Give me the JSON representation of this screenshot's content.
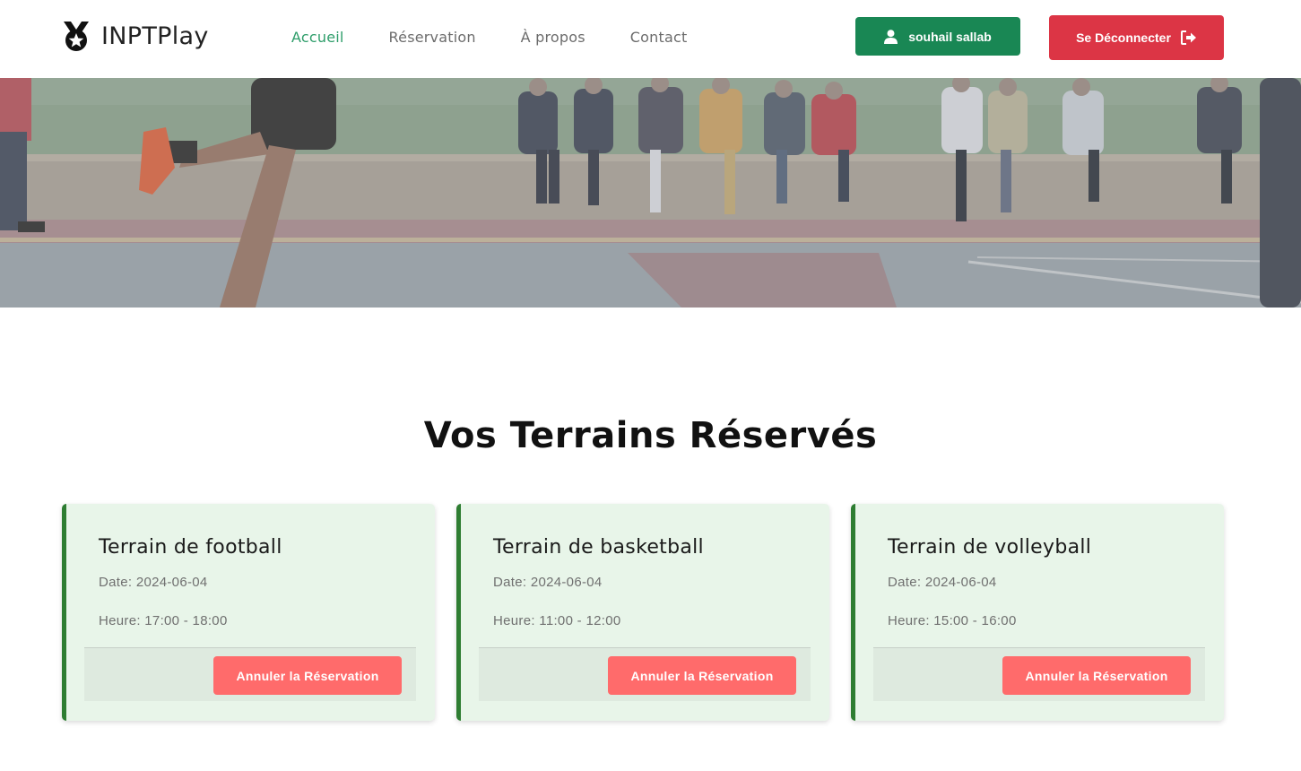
{
  "brand": {
    "name": "INPTPlay",
    "logo_icon": "medal-icon"
  },
  "nav": {
    "items": [
      {
        "label": "Accueil",
        "active": true
      },
      {
        "label": "Réservation",
        "active": false
      },
      {
        "label": "À propos",
        "active": false
      },
      {
        "label": "Contact",
        "active": false
      }
    ]
  },
  "user": {
    "name": "souhail sallab",
    "icon": "user-icon"
  },
  "logout": {
    "label": "Se Déconnecter",
    "icon": "sign-out-icon"
  },
  "section": {
    "title": "Vos Terrains Réservés"
  },
  "reservations": [
    {
      "title": "Terrain de football",
      "date": "Date: 2024-06-04",
      "time": "Heure: 17:00 - 18:00",
      "cancel_label": "Annuler la Réservation"
    },
    {
      "title": "Terrain de basketball",
      "date": "Date: 2024-06-04",
      "time": "Heure: 11:00 - 12:00",
      "cancel_label": "Annuler la Réservation"
    },
    {
      "title": "Terrain de volleyball",
      "date": "Date: 2024-06-04",
      "time": "Heure: 15:00 - 16:00",
      "cancel_label": "Annuler la Réservation"
    }
  ],
  "colors": {
    "primary_green": "#198754",
    "danger_red": "#dc3545",
    "cancel_red": "#ff6b6b",
    "nav_active": "#2e9d6a",
    "card_bg": "#e8f5e9",
    "card_border": "#2e7d32"
  }
}
